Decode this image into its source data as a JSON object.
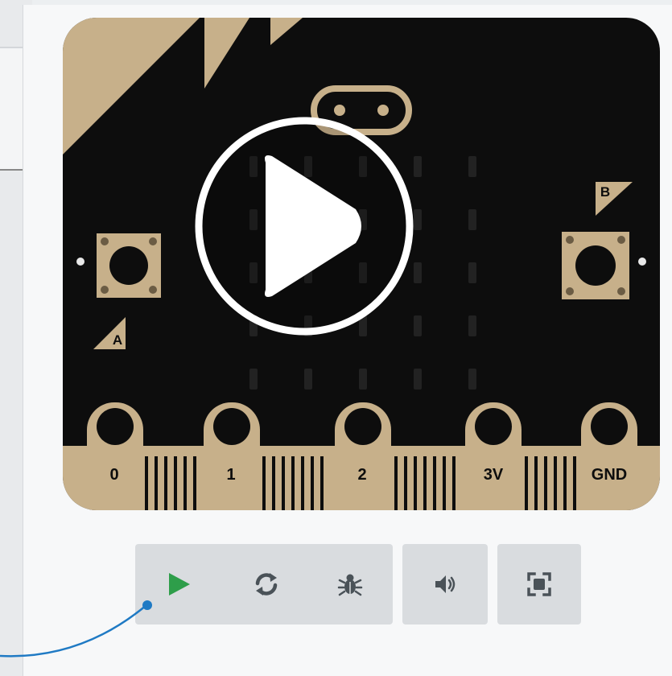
{
  "board": {
    "pins": [
      "0",
      "1",
      "2",
      "3V",
      "GND"
    ],
    "button_a_label": "A",
    "button_b_label": "B",
    "overlay_icon": "play-circle-icon"
  },
  "toolbar": {
    "play_icon": "play-icon",
    "restart_icon": "restart-icon",
    "debug_icon": "bug-icon",
    "mute_icon": "speaker-icon",
    "fullscreen_icon": "fullscreen-icon"
  },
  "colors": {
    "board": "#0d0d0d",
    "gold": "#c7b08a",
    "play_green": "#2e9e4a",
    "toolbar_bg": "#d9dcdf",
    "icon_gray": "#4a5258",
    "annotation_blue": "#1f7ac4"
  }
}
